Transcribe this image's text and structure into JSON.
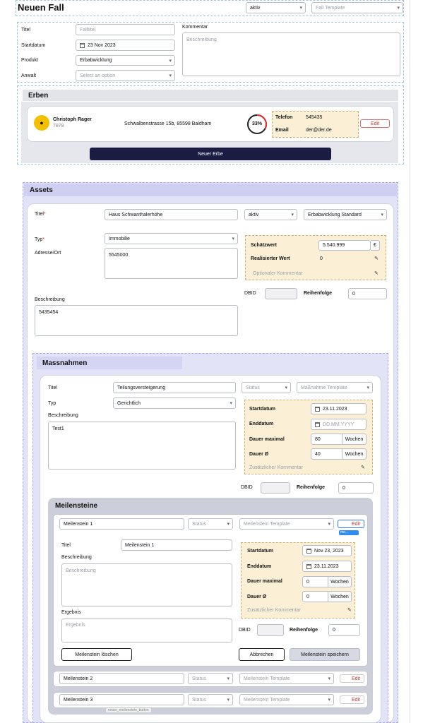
{
  "header": {
    "title": "Neuen Fall",
    "status": "aktiv",
    "template": "Fall Template"
  },
  "fall": {
    "titel_label": "Titel",
    "titel_placeholder": "Falltitel",
    "start_label": "Startdatum",
    "start_value": "23 Nov 2023",
    "produkt_label": "Produkt",
    "produkt_value": "Erbabwicklung",
    "anwalt_label": "Anwalt",
    "anwalt_placeholder": "Select an option",
    "kommentar_label": "Kommentar",
    "kommentar_placeholder": "Beschreibung"
  },
  "erben": {
    "title": "Erben",
    "name": "Christoph Rager",
    "id": "7878",
    "address": "Schwalbenstrasse 15b, 85598 Baldham",
    "percent": "33%",
    "percent_value": 0.33,
    "telefon_label": "Telefon",
    "telefon": "545435",
    "email_label": "Email",
    "email": "der@der.de",
    "edit": "Edit",
    "new_button": "Neuer Erbe"
  },
  "assets": {
    "title": "Assets",
    "titel_label": "Titel",
    "titel_value": "Haus Schwanthalerhöhe",
    "status": "aktiv",
    "template": "Erbabwicklung Standard",
    "typ_label": "Typ",
    "typ_value": "Immobilie",
    "adresse_label": "Adresse/Ort",
    "adresse_value": "5545000",
    "beschreibung_label": "Beschreibung",
    "beschreibung_value": "5435454",
    "schaetzwert_label": "Schätzwert",
    "schaetzwert_value": "5.540.999",
    "currency": "€",
    "realisiert_label": "Realisierter Wert",
    "realisiert_value": "0",
    "kommentar_placeholder": "Optionaler Kommentar",
    "dbid_label": "DBID",
    "reihenfolge_label": "Reihenfolge",
    "reihenfolge_value": "0"
  },
  "massnahmen": {
    "title": "Massnahmen",
    "titel_label": "Titel",
    "titel_value": "Teilungsversteigerung",
    "status_placeholder": "Status",
    "template_placeholder": "Maßnahme Template",
    "typ_label": "Typ",
    "typ_value": "Gerichtlich",
    "beschreibung_label": "Beschreibung",
    "beschreibung_value": "Test1",
    "start_label": "Startdatum",
    "start_value": "23.11.2023",
    "end_label": "Enddatum",
    "end_placeholder": "DD.MM.YYYY",
    "dauer_max_label": "Dauer maximal",
    "dauer_max_value": "80",
    "dauer_avg_label": "Dauer Ø",
    "dauer_avg_value": "40",
    "unit": "Wochen",
    "kommentar_placeholder": "Zusätzlicher Kommentar",
    "dbid_label": "DBID",
    "reihenfolge_label": "Reihenfolge",
    "reihenfolge_value": "0"
  },
  "meilensteine": {
    "title": "Meilensteine",
    "status_placeholder": "Status",
    "template_placeholder": "Meilenstein Template",
    "edit": "Edit",
    "tooltip": "me...",
    "rows": [
      {
        "name": "Meilenstein 1"
      },
      {
        "name": "Meilenstein 2"
      },
      {
        "name": "Meilenstein 3"
      }
    ],
    "form": {
      "titel_label": "Titel",
      "titel_value": "Meilenstein 1",
      "beschreibung_label": "Beschreibung",
      "beschreibung_placeholder": "Beschreibung",
      "ergebnis_label": "Ergebnis",
      "ergebnis_placeholder": "Ergebnis",
      "start_label": "Startdatum",
      "start_value": "Nov 23, 2023",
      "end_label": "Enddatum",
      "end_value": "23.11.2023",
      "dauer_max_label": "Dauer maximal",
      "dauer_max_value": "0",
      "dauer_avg_label": "Dauer Ø",
      "dauer_avg_value": "0",
      "unit": "Wochen",
      "kommentar_placeholder": "Zusätzlicher Kommentar",
      "dbid_label": "DBID",
      "reihenfolge_label": "Reihenfolge",
      "reihenfolge_value": "0",
      "delete_button": "Meilenstein löschen",
      "cancel_button": "Abbrechen",
      "save_button": "Meilenstein speichern"
    },
    "new_button_tag": "neuer_meilenstein_button"
  }
}
